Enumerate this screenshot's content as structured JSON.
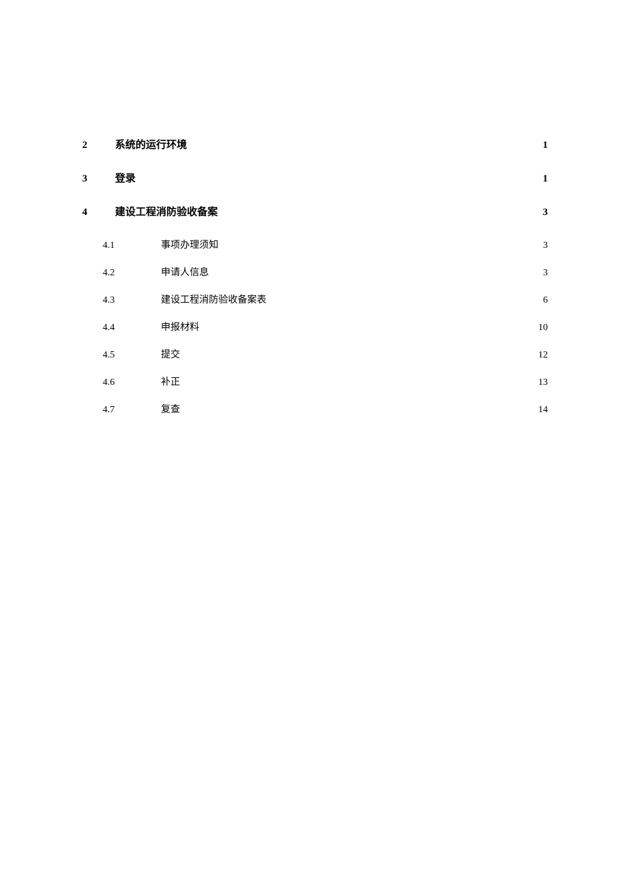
{
  "toc": {
    "entries": [
      {
        "num": "2",
        "title": "系统的运行环境",
        "page": "1",
        "level": 1
      },
      {
        "num": "3",
        "title": "登录",
        "page": "1",
        "level": 1
      },
      {
        "num": "4",
        "title": "建设工程消防验收备案",
        "page": "3",
        "level": 1
      },
      {
        "num": "4.1",
        "title": "事项办理须知",
        "page": "3",
        "level": 2
      },
      {
        "num": "4.2",
        "title": "申请人信息",
        "page": "3",
        "level": 2
      },
      {
        "num": "4.3",
        "title": "建设工程消防验收备案表",
        "page": "6",
        "level": 2
      },
      {
        "num": "4.4",
        "title": "申报材料",
        "page": "10",
        "level": 2
      },
      {
        "num": "4.5",
        "title": "提交",
        "page": "12",
        "level": 2
      },
      {
        "num": "4.6",
        "title": "补正",
        "page": "13",
        "level": 2
      },
      {
        "num": "4.7",
        "title": "复查",
        "page": "14",
        "level": 2
      }
    ]
  }
}
